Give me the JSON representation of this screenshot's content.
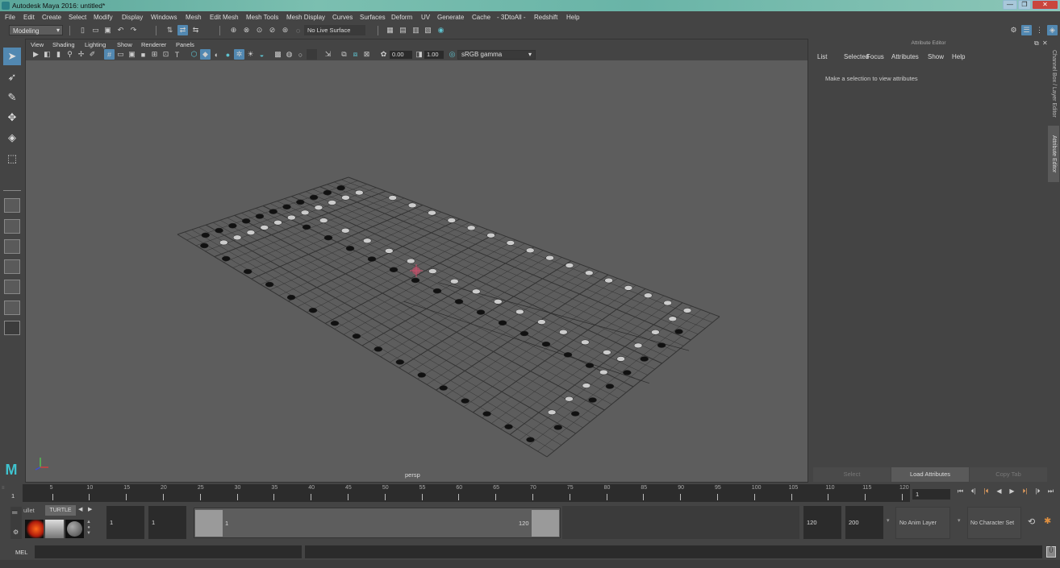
{
  "window": {
    "title": "Autodesk Maya 2016: untitled*",
    "controls": {
      "minimize": "—",
      "restore": "❐",
      "close": "✕"
    }
  },
  "menubar": {
    "items": [
      "File",
      "Edit",
      "Create",
      "Select",
      "Modify",
      "Display",
      "Windows",
      "Mesh",
      "Edit Mesh",
      "Mesh Tools",
      "Mesh Display",
      "Curves",
      "Surfaces",
      "Deform",
      "UV",
      "Generate",
      "Cache",
      "- 3DtoAll -",
      "Redshift",
      "Help"
    ]
  },
  "statusline": {
    "menuset": "Modeling",
    "live_surface": "No Live Surface"
  },
  "toolbox": {
    "tools": [
      "select-tool",
      "lasso-tool",
      "paint-select-tool",
      "move-tool",
      "rotate-tool",
      "scale-tool"
    ]
  },
  "viewport": {
    "menu": [
      "View",
      "Shading",
      "Lighting",
      "Show",
      "Renderer",
      "Panels"
    ],
    "exposure": "0.00",
    "gamma": "1.00",
    "color_space": "sRGB gamma",
    "camera_label": "persp",
    "accent_color": "#5288b1"
  },
  "attribute_editor": {
    "title": "Attribute Editor",
    "menu": [
      "List",
      "Selected",
      "Focus",
      "Attributes",
      "Show",
      "Help"
    ],
    "message": "Make a selection to view attributes",
    "buttons": {
      "select": "Select",
      "load": "Load Attributes",
      "copy": "Copy Tab"
    }
  },
  "side_tabs": [
    "Channel Box / Layer Editor",
    "Attribute Editor"
  ],
  "timeline": {
    "ticks": [
      "5",
      "10",
      "15",
      "20",
      "25",
      "30",
      "35",
      "40",
      "45",
      "50",
      "55",
      "60",
      "65",
      "70",
      "75",
      "80",
      "85",
      "90",
      "95",
      "100",
      "105",
      "110",
      "115",
      "120"
    ],
    "current_frame_marker": "1",
    "current_frame": "1",
    "playback": [
      "⏮",
      "⏴|",
      "|⏴",
      "◀",
      "▶",
      "⏵|",
      "|⏵",
      "⏭"
    ]
  },
  "range": {
    "shelf_tabs": [
      "ullet",
      "TURTLE"
    ],
    "start_time": "1",
    "playback_start": "1",
    "range_start_label": "1",
    "range_end_label": "120",
    "playback_end": "120",
    "end_time": "200",
    "anim_layer": "No Anim Layer",
    "character_set": "No Character Set"
  },
  "command_line": {
    "label": "MEL",
    "value": ""
  }
}
